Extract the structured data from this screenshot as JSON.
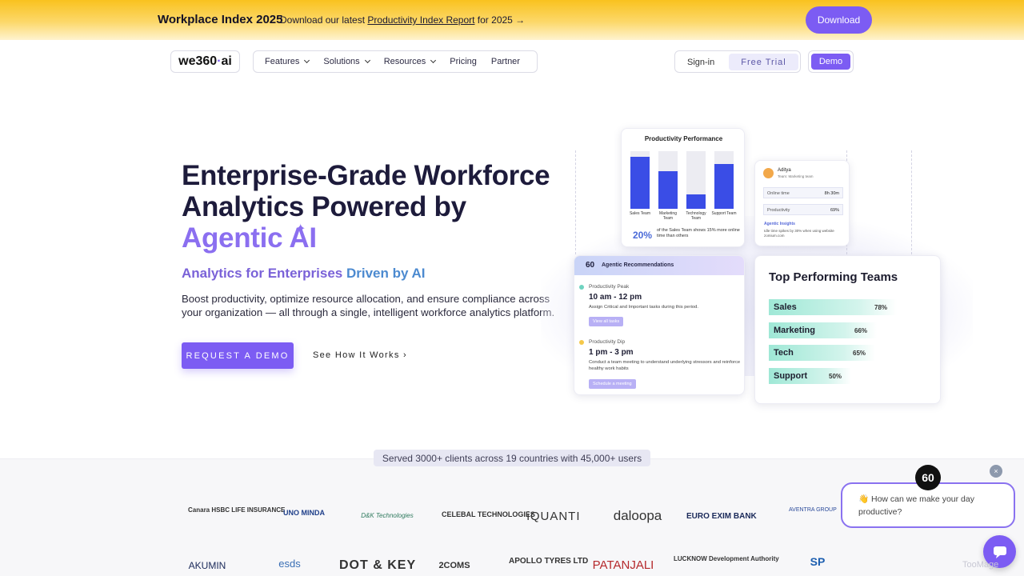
{
  "announcement": {
    "title": "Workplace Index 2025",
    "text_before": "Download our latest ",
    "link": "Productivity Index Report",
    "text_after": " for 2025 →",
    "button": "Download"
  },
  "nav": {
    "logo": "we360",
    "logo_dot": "·",
    "logo_suffix": "ai",
    "items": [
      "Features",
      "Solutions",
      "Resources",
      "Pricing",
      "Partner"
    ],
    "signin": "Sign-in",
    "trial": "Free Trial",
    "demo": "Demo"
  },
  "hero": {
    "title_line1": "Enterprise-Grade Workforce",
    "title_line2": "Analytics Powered by",
    "title_line3": "Agentic AI",
    "sub_part1": "Analytics for Enterprises ",
    "sub_part2": "Driven by AI",
    "description": "Boost productivity, optimize resource allocation, and ensure compliance across your organization — all through a single, intelligent workforce analytics platform.",
    "cta_primary": "REQUEST A DEMO",
    "cta_secondary": "See How It Works ›"
  },
  "perf_card": {
    "title": "Productivity Performance",
    "bars": [
      {
        "label": "Sales Team",
        "value": 0.9
      },
      {
        "label": "Marketing Team",
        "value": 0.65
      },
      {
        "label": "Technology Team",
        "value": 0.25
      },
      {
        "label": "Support Team",
        "value": 0.78
      }
    ],
    "pct": "20%",
    "note": "of the Sales Team shows 15% more online time than others"
  },
  "user_card": {
    "name": "Aditya",
    "team": "Team: Marketing team",
    "online_label": "Online time",
    "online_value": "8h 30m",
    "prod_label": "Productivity",
    "prod_value": "69%",
    "insights_title": "Agentic Insights",
    "insights_text": "Idle time spikes by 30% when using website zomium.com"
  },
  "rec_card": {
    "logo": "60",
    "title": "Agentic Recommendations",
    "peak_label": "Productivity Peak",
    "peak_time": "10 am - 12 pm",
    "peak_text": "Assign Critical and Important tasks during this period.",
    "peak_chip": "View all tasks",
    "dip_label": "Productivity Dip",
    "dip_time": "1 pm - 3 pm",
    "dip_text": "Conduct a team meeting to understand underlying stressors and reinforce healthy work habits",
    "dip_chip": "Schedule a meeting"
  },
  "top_teams": {
    "title": "Top Performing Teams",
    "teams": [
      {
        "name": "Sales",
        "value": "78%",
        "fraction": 0.78
      },
      {
        "name": "Marketing",
        "value": "66%",
        "fraction": 0.66
      },
      {
        "name": "Tech",
        "value": "65%",
        "fraction": 0.65
      },
      {
        "name": "Support",
        "value": "50%",
        "fraction": 0.5
      }
    ]
  },
  "clients": {
    "served": "Served 3000+ clients across 19 countries with 45,000+ users",
    "row1": [
      "Canara HSBC LIFE INSURANCE",
      "UNO MINDA",
      "D&K Technologies",
      "CELEBAL TECHNOLOGIES",
      "iQUANTI",
      "daloopa",
      "EURO EXIM BANK",
      "AVENTRA GROUP"
    ],
    "row2": [
      "AKUMIN",
      "esds",
      "DOT & KEY",
      "2COMS",
      "APOLLO TYRES LTD",
      "PATANJALI",
      "LUCKNOW Development Authority",
      "SP"
    ]
  },
  "chat": {
    "message": "👋 How can we make your day productive?",
    "avatar": "60",
    "close": "×"
  },
  "watermark": "TooMage",
  "colors": {
    "accent": "#7c5cf3",
    "announce_bg": "#f9c21f",
    "bar_blue": "#3a4de6",
    "team_bar": "#9fe8d6"
  }
}
